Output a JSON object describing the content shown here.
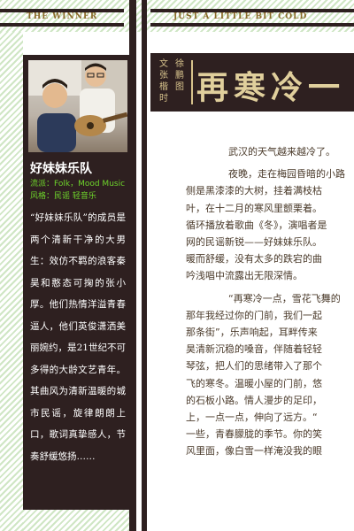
{
  "header": {
    "left_text": "THE WINNER",
    "right_text": "JUST A LITTLE BIT COLD"
  },
  "band": {
    "photo_icon": "band-photo",
    "name": "好妹妹乐队",
    "genre": "流派：Folk，Mood Music",
    "style": "风格：民谣 轻音乐",
    "description": "“好妹妹乐队”的成员是两个清新干净的大男生：效仿不羁的浪客秦昊和憨态可掬的张小厚。他们热情洋溢青春逼人，他们英俊潇洒美丽婉约，是21世纪不可多得的大龄文艺青年。其曲风为清新温暖的城市民谣，旋律朗朗上口，歌词真挚感人，节奏舒缓悠扬……"
  },
  "credits": {
    "author_lines": [
      "文",
      "张",
      "楷",
      "时"
    ],
    "author_lines2": [
      "徐",
      "鹏",
      "图"
    ]
  },
  "article_title": "再寒冷一",
  "article": {
    "lines": [
      "武汉的天气越来越冷了。",
      "夜晚，走在梅园昏暗的小路",
      "侧是黑漆漆的大树，挂着满枝枯",
      "叶，在十二月的寒风里颤栗着。",
      "循环播放着歌曲《冬》，演唱者是",
      "网的民谣新锐——好妹妹乐队。",
      "暖而舒缓，没有太多的跌宕的曲",
      "吟浅唱中流露出无限深情。",
      "“再寒冷一点，雪花飞舞的",
      "那年我经过你的门前，我们一起",
      "那条街”，乐声响起，耳畔传来",
      "昊清新沉稳的嗓音，伴随着轻轻",
      "琴弦，把人们的思绪带入了那个",
      "飞的寒冬。温暖小屋的门前，悠",
      "的石板小路。情人漫步的足印，",
      "上，一点一点，伸向了远方。“",
      "一些，青春朦胧的季节。你的笑",
      "风里面，像白雪一样淹没我的眼"
    ]
  }
}
